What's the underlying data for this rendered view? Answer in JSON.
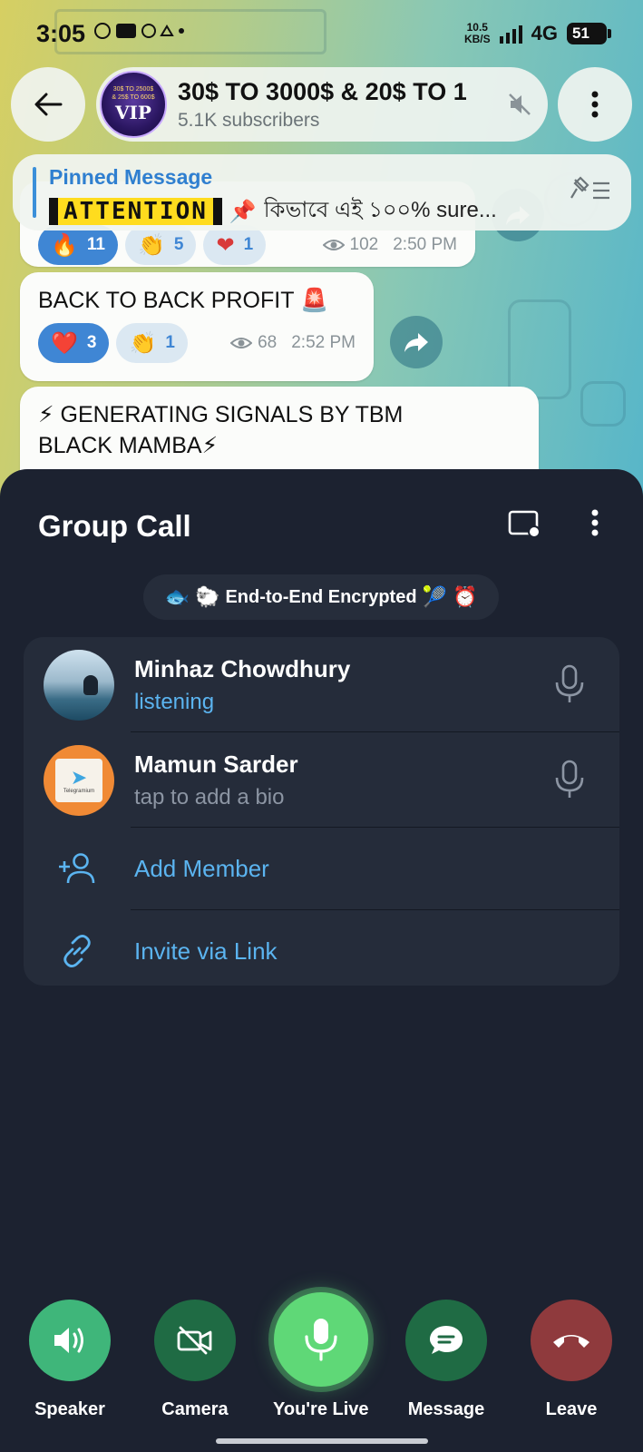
{
  "status_bar": {
    "time": "3:05",
    "notification_icons": [
      "●"
    ],
    "net_speed_value": "10.5",
    "net_speed_unit": "KB/S",
    "network": "4G",
    "battery": "51"
  },
  "chat_header": {
    "channel_name": "30$ TO 3000$ & 20$ TO 1",
    "subscribers": "5.1K subscribers",
    "avatar_text_top": "30$ TO 2500$",
    "avatar_text_mid": "& 25$ TO 600$",
    "avatar_text_vip": "VIP"
  },
  "pinned": {
    "title": "Pinned Message",
    "attention": "ATTENTION",
    "pin_emoji": "📌",
    "body": "কিভাবে এই ১০০% sure..."
  },
  "messages": [
    {
      "text": "",
      "reactions": [
        {
          "emoji": "🔥",
          "count": "11",
          "mine": true
        },
        {
          "emoji": "👏",
          "count": "5",
          "mine": false
        },
        {
          "emoji": "❤",
          "count": "1",
          "mine": false
        }
      ],
      "views": "102",
      "time": "2:50 PM"
    },
    {
      "text": "BACK TO BACK PROFIT 🚨",
      "reactions": [
        {
          "emoji": "❤️",
          "count": "3",
          "mine": true
        },
        {
          "emoji": "👏",
          "count": "1",
          "mine": false
        }
      ],
      "views": "68",
      "time": "2:52 PM"
    },
    {
      "text": "⚡ GENERATING SIGNALS BY TBM BLACK MAMBA⚡"
    }
  ],
  "group_call": {
    "title": "Group Call",
    "encryption_emojis_left": "🐟 🐑",
    "encryption_label": "End-to-End Encrypted",
    "encryption_emojis_right": "🎾 ⏰",
    "members": [
      {
        "name": "Minhaz Chowdhury",
        "status": "listening"
      },
      {
        "name": "Mamun Sarder",
        "status": "tap to add a bio",
        "avatar_label": "Telegramium"
      }
    ],
    "add_member_label": "Add Member",
    "invite_label": "Invite via Link"
  },
  "controls": {
    "speaker": "Speaker",
    "camera": "Camera",
    "live": "You're Live",
    "message": "Message",
    "leave": "Leave"
  },
  "colors": {
    "accent_blue": "#5bb4f0",
    "sheet_bg": "#1c2230",
    "speaker_green": "#3fb67a",
    "camera_green": "#1f6b44",
    "live_green": "#5fd877",
    "message_green": "#1f6b44",
    "leave_red": "#8f3a3d"
  }
}
